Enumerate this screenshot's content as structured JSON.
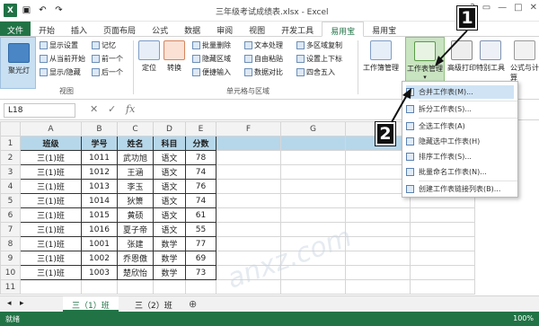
{
  "window": {
    "title": "三年级考试成绩表.xlsx - Excel",
    "qat_icons": [
      "excel-logo-icon",
      "save-icon",
      "undo-icon",
      "redo-icon"
    ],
    "controls": [
      "?",
      "▭",
      "—",
      "□",
      "✕"
    ]
  },
  "tabs": [
    "文件",
    "开始",
    "插入",
    "页面布局",
    "公式",
    "数据",
    "审阅",
    "视图",
    "开发工具",
    "易用宝",
    "易用宝"
  ],
  "active_tab_index": 9,
  "ribbon": {
    "freeze_label": "聚光灯",
    "view_group": {
      "label": "视图",
      "items": [
        "显示设置",
        "记忆",
        "从当前开始",
        "前一个",
        "显示/隐藏",
        "后一个"
      ]
    },
    "locate_label": "定位",
    "convert_label": "转换",
    "cells_group": {
      "label": "单元格与区域",
      "items": [
        "批量删除",
        "文本处理",
        "多区域复制",
        "隐藏区域",
        "自由粘贴",
        "设置上下标",
        "便捷输入",
        "数据对比",
        "四舍五入"
      ]
    },
    "right_buttons": [
      "工作簿管理",
      "工作表管理",
      "高级打印",
      "特别工具",
      "公式与计算"
    ]
  },
  "formula_bar": {
    "name_box": "L18",
    "fx": "fx",
    "value": ""
  },
  "sheet": {
    "columns": [
      "A",
      "B",
      "C",
      "D",
      "E",
      "F",
      "G",
      "H",
      "I"
    ],
    "rows": [
      [
        "班级",
        "学号",
        "姓名",
        "科目",
        "分数"
      ],
      [
        "三(1)班",
        "1011",
        "武功旭",
        "语文",
        "78"
      ],
      [
        "三(1)班",
        "1012",
        "王涵",
        "语文",
        "74"
      ],
      [
        "三(1)班",
        "1013",
        "李玉",
        "语文",
        "76"
      ],
      [
        "三(1)班",
        "1014",
        "狄箫",
        "语文",
        "74"
      ],
      [
        "三(1)班",
        "1015",
        "黄硕",
        "语文",
        "61"
      ],
      [
        "三(1)班",
        "1016",
        "夏子帝",
        "语文",
        "55"
      ],
      [
        "三(1)班",
        "1001",
        "张建",
        "数学",
        "77"
      ],
      [
        "三(1)班",
        "1002",
        "乔恩傲",
        "数学",
        "69"
      ],
      [
        "三(1)班",
        "1003",
        "楚欣怡",
        "数学",
        "73"
      ]
    ],
    "row_numbers": [
      "1",
      "2",
      "3",
      "4",
      "5",
      "6",
      "7",
      "8",
      "9",
      "10",
      "11"
    ]
  },
  "sheet_tabs": [
    "三（1）班",
    "三（2）班"
  ],
  "add_sheet": "⊕",
  "status": {
    "left": "就绪",
    "zoom": "100%"
  },
  "dropdown": {
    "items": [
      "合并工作表(M)...",
      "拆分工作表(S)...",
      "全选工作表(A)",
      "隐藏选中工作表(H)",
      "排序工作表(S)...",
      "批量命名工作表(N)...",
      "创建工作表链接列表(B)..."
    ]
  },
  "callouts": [
    "1",
    "2"
  ],
  "watermark": "anxz.com",
  "colors": {
    "excel_green": "#217346",
    "header_fill": "#b6d7ea",
    "menu_hover": "#cfe3f5"
  }
}
